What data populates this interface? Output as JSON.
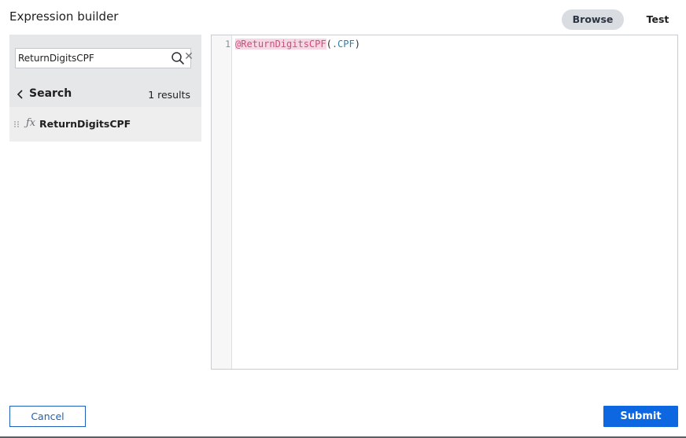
{
  "dialog": {
    "title": "Expression builder"
  },
  "mode_toggle": {
    "browse_label": "Browse",
    "test_label": "Test",
    "active": "Browse"
  },
  "search": {
    "value": "ReturnDigitsCPF",
    "placeholder": "",
    "header_label": "Search",
    "results_label": "1 results"
  },
  "results": [
    {
      "icon": "fx-icon",
      "name": "ReturnDigitsCPF"
    }
  ],
  "editor": {
    "line_numbers": [
      "1"
    ],
    "tokens": {
      "func": "@ReturnDigitsCPF",
      "open": "(",
      "field": ".CPF",
      "close": ")"
    }
  },
  "footer": {
    "cancel_label": "Cancel",
    "submit_label": "Submit"
  },
  "colors": {
    "accent": "#0d67e0",
    "panel": "#e6e7e8",
    "active_toggle": "#d9dde2",
    "func_token": "#d6497a",
    "field_token": "#2d7fa8"
  }
}
